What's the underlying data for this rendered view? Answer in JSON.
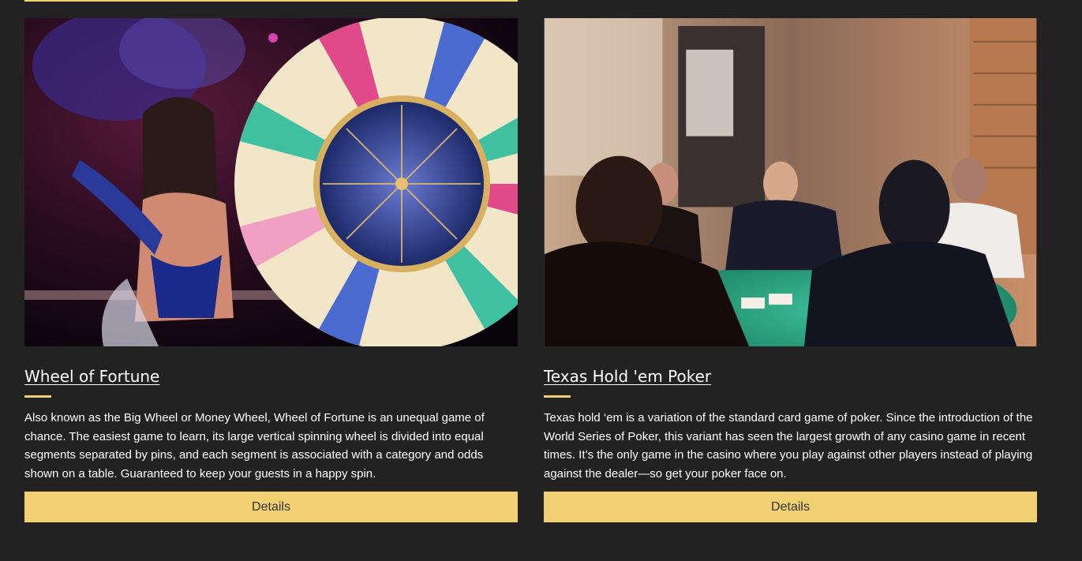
{
  "cards": [
    {
      "title": "Wheel of Fortune",
      "description": "Also known as the Big Wheel or Money Wheel, Wheel of Fortune is an unequal game of chance. The easiest game to learn, its large vertical spinning wheel is divided into equal segments separated by pins, and each segment is associated with a category and odds shown on a table. Guaranteed to keep your guests in a happy spin.",
      "button_label": "Details"
    },
    {
      "title": "Texas Hold 'em Poker",
      "description": "Texas hold ‘em is a variation of the standard card game of poker. Since the introduction of the World Series of Poker, this variant has seen the largest growth of any casino game in recent times. It’s the only game in the casino where you play against other players instead of playing against the dealer—so get your poker face on.",
      "button_label": "Details"
    }
  ],
  "colors": {
    "background": "#222222",
    "accent": "#f0d070",
    "button_text": "#333333",
    "text": "#ffffff"
  }
}
